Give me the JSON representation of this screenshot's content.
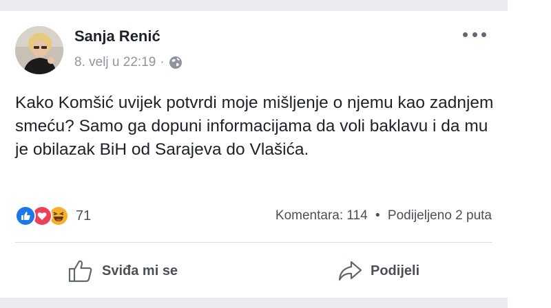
{
  "post": {
    "author": "Sanja Renić",
    "timestamp": "8. velj u 22:19",
    "privacy_icon": "globe-icon",
    "more_icon": "more-options-icon",
    "text": "Kako Komšić uvijek potvrdi moje mišljenje o njemu kao zadnjem smeću? Samo ga dopuni informacijama da voli baklavu i da mu je obilazak BiH od Sarajeva do Vlašića."
  },
  "reactions": {
    "types": [
      "like",
      "love",
      "haha"
    ],
    "count": "71"
  },
  "stats": {
    "comments": "Komentara: 114",
    "shares": "Podijeljeno 2 puta"
  },
  "actions": {
    "like_label": "Sviđa mi se",
    "share_label": "Podijeli"
  },
  "colors": {
    "like_blue": "#1877f2",
    "love_red": "#f33e58",
    "haha_yellow": "#f7b125",
    "text": "#1d2129",
    "muted": "#90949c",
    "band": "#e9ebee"
  }
}
